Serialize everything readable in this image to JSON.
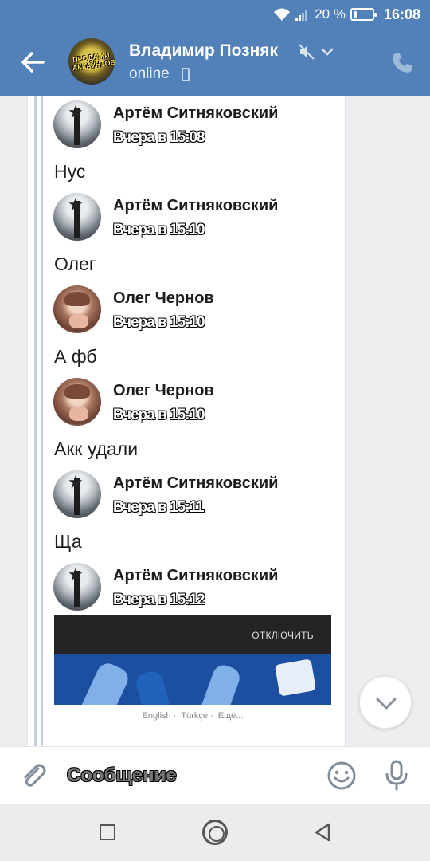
{
  "status_bar": {
    "battery": "20 %",
    "battery_level": 0.2,
    "time": "16:08"
  },
  "header": {
    "avatar_text": "ПРОДАЖИ АККАУНТОВ",
    "name": "Владимир Позняк",
    "status": "online"
  },
  "messages": [
    {
      "author": "Артём Ситняковский",
      "time": "Вчера в 15:08",
      "text": "Нус",
      "avatar": "gray"
    },
    {
      "author": "Артём Ситняковский",
      "time": "Вчера в 15:10",
      "text": "Олег",
      "avatar": "gray"
    },
    {
      "author": "Олег Чернов",
      "time": "Вчера в 15:10",
      "text": "А фб",
      "avatar": "anime"
    },
    {
      "author": "Олег Чернов",
      "time": "Вчера в 15:10",
      "text": "Акк удали",
      "avatar": "anime"
    },
    {
      "author": "Артём Ситняковский",
      "time": "Вчера в 15:11",
      "text": "Ща",
      "avatar": "gray"
    },
    {
      "author": "Артём Ситняковский",
      "time": "Вчера в 15:12",
      "text": "",
      "avatar": "gray"
    }
  ],
  "attachment": {
    "disable_label": "ОТКЛЮЧИТЬ",
    "links": [
      "English",
      "Türkçe",
      "Ещё..."
    ]
  },
  "input": {
    "placeholder": "Сообщение"
  },
  "colors": {
    "header": "#5181b8",
    "background": "#edeef0"
  }
}
